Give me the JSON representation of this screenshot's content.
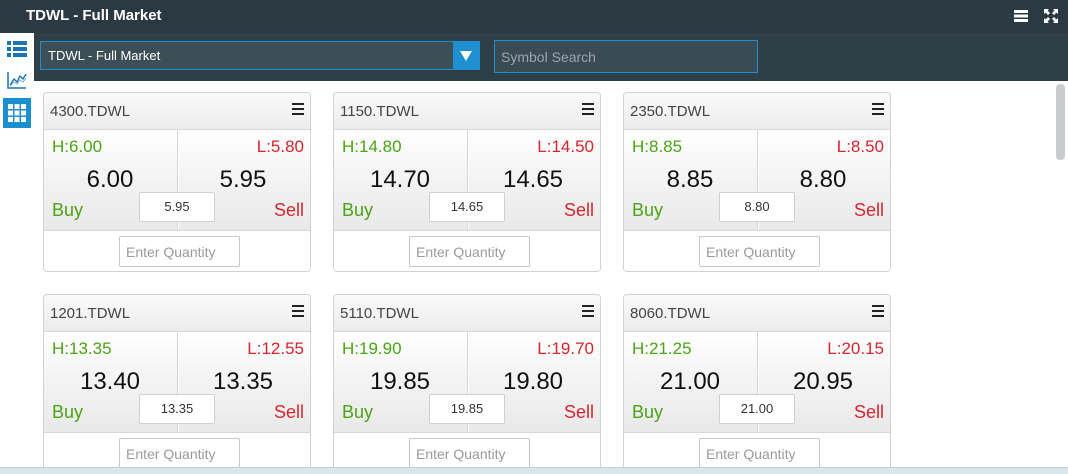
{
  "window": {
    "title": "TDWL - Full Market",
    "controls": [
      "menu-icon",
      "expand-icon"
    ]
  },
  "sidebar": {
    "items": [
      {
        "icon": "list-icon",
        "active": false
      },
      {
        "icon": "chart-icon",
        "active": false
      },
      {
        "icon": "grid-icon",
        "active": true
      }
    ]
  },
  "toolbar": {
    "market_select": "TDWL - Full Market",
    "search_placeholder": "Symbol Search"
  },
  "common": {
    "buy_label": "Buy",
    "sell_label": "Sell",
    "qty_placeholder": "Enter Quantity"
  },
  "colors": {
    "buy": "#4ba315",
    "sell": "#d3262e",
    "accent": "#1e8fd0",
    "header": "#2b3a42"
  },
  "cards": [
    {
      "symbol": "4300.TDWL",
      "high": "H:6.00",
      "low": "L:5.80",
      "bid": "6.00",
      "ask": "5.95",
      "last": "5.95"
    },
    {
      "symbol": "1150.TDWL",
      "high": "H:14.80",
      "low": "L:14.50",
      "bid": "14.70",
      "ask": "14.65",
      "last": "14.65"
    },
    {
      "symbol": "2350.TDWL",
      "high": "H:8.85",
      "low": "L:8.50",
      "bid": "8.85",
      "ask": "8.80",
      "last": "8.80"
    },
    {
      "symbol": "1201.TDWL",
      "high": "H:13.35",
      "low": "L:12.55",
      "bid": "13.40",
      "ask": "13.35",
      "last": "13.35"
    },
    {
      "symbol": "5110.TDWL",
      "high": "H:19.90",
      "low": "L:19.70",
      "bid": "19.85",
      "ask": "19.80",
      "last": "19.85"
    },
    {
      "symbol": "8060.TDWL",
      "high": "H:21.25",
      "low": "L:20.15",
      "bid": "21.00",
      "ask": "20.95",
      "last": "21.00"
    }
  ]
}
